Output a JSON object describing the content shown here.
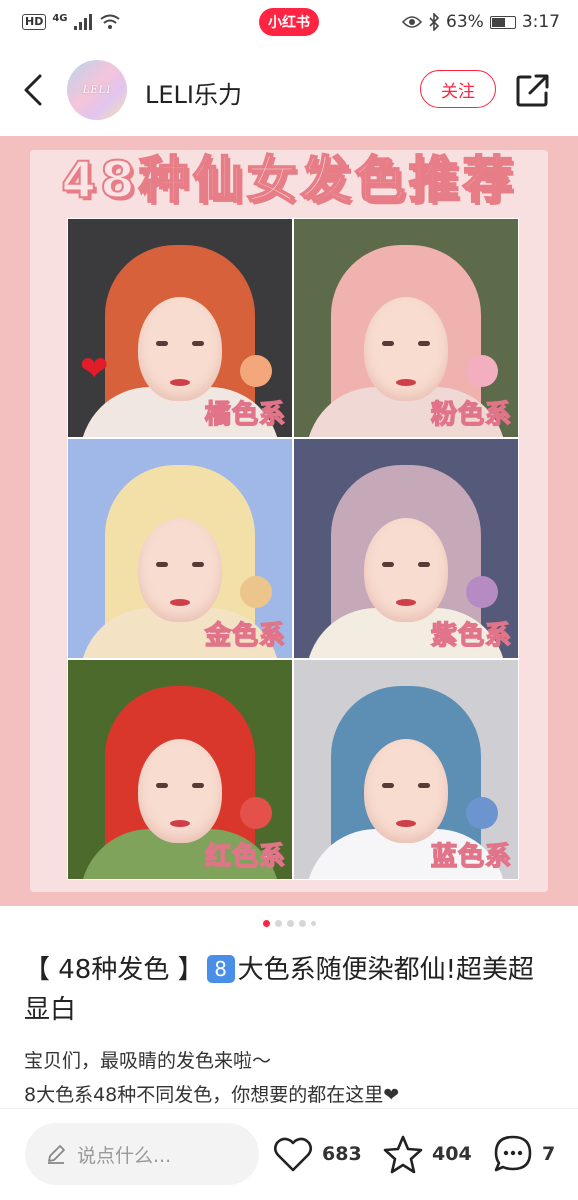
{
  "status_bar": {
    "hd": "HD",
    "network": "4G",
    "app_badge": "小红书",
    "battery": "63%",
    "battery_level": 0.63,
    "time": "3:17"
  },
  "header": {
    "author_name": "LELI乐力",
    "avatar_text": "LELI",
    "follow_label": "关注"
  },
  "cover": {
    "title": "48种仙女发色推荐",
    "cells": [
      {
        "label": "橘色系",
        "swatch": "#f5a77c",
        "hair": "#d7613a",
        "bg": "#3b3b3d",
        "body": "#f1e7e2"
      },
      {
        "label": "粉色系",
        "swatch": "#f3aec0",
        "hair": "#f0b2ae",
        "bg": "#5d6b4a",
        "body": "#f0d8d4"
      },
      {
        "label": "金色系",
        "swatch": "#ecc58d",
        "hair": "#f3e0a8",
        "bg": "#9fb8e8",
        "body": "#f4e2c5"
      },
      {
        "label": "紫色系",
        "swatch": "#b68ac3",
        "hair": "#c6a9b9",
        "bg": "#565a7a",
        "body": "#f3ece0"
      },
      {
        "label": "红色系",
        "swatch": "#e4514b",
        "hair": "#d9372b",
        "bg": "#4c6a2c",
        "body": "#7fa35a"
      },
      {
        "label": "蓝色系",
        "swatch": "#6c94cf",
        "hair": "#5d8fb5",
        "bg": "#cfcfd3",
        "body": "#f6f6f8"
      }
    ]
  },
  "carousel": {
    "count": 5,
    "active": 0
  },
  "post": {
    "title_prefix": "【 48种发色 】",
    "title_badge": "8",
    "title_suffix": "大色系随便染都仙!超美超显白",
    "body_lines": [
      "宝贝们，最吸睛的发色来啦～",
      "8大色系48种不同发色，你想要的都在这里❤"
    ]
  },
  "bottom_bar": {
    "comment_placeholder": "说点什么...",
    "likes": "683",
    "collects": "404",
    "comments": "7"
  }
}
